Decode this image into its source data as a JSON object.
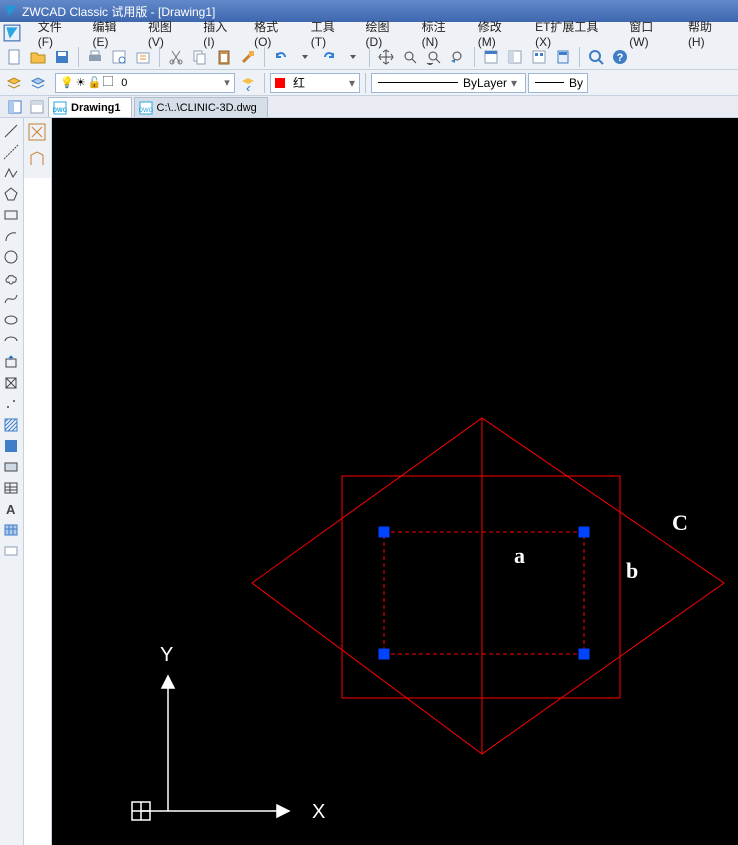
{
  "titlebar": {
    "text": "ZWCAD Classic 试用版 - [Drawing1]"
  },
  "menu": {
    "items": [
      "文件(F)",
      "编辑(E)",
      "视图(V)",
      "插入(I)",
      "格式(O)",
      "工具(T)",
      "绘图(D)",
      "标注(N)",
      "修改(M)",
      "ET扩展工具(X)",
      "窗口(W)",
      "帮助(H)"
    ]
  },
  "layer": {
    "name": "0"
  },
  "color": {
    "swatch": "#ff0000",
    "label": "红"
  },
  "linetype": {
    "label": "ByLayer"
  },
  "lineweight": {
    "label": "By"
  },
  "tabs": {
    "active": 0,
    "items": [
      {
        "label": "Drawing1"
      },
      {
        "label": "C:\\..\\CLINIC-3D.dwg"
      }
    ]
  },
  "canvas": {
    "labels": {
      "a": "a",
      "b": "b",
      "c": "C",
      "x": "X",
      "y": "Y"
    }
  }
}
